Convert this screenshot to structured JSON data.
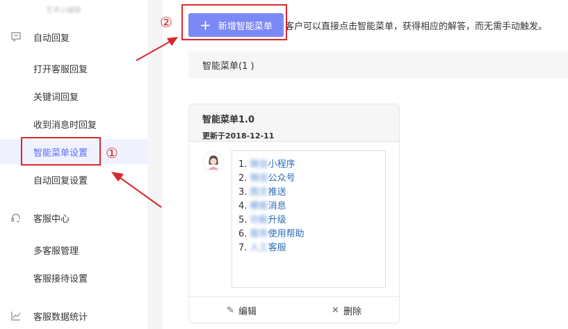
{
  "sidebar": {
    "logo_text": "艺术小编辑",
    "sections": [
      {
        "label": "自动回复",
        "icon": "chat-icon"
      },
      {
        "label": "客服中心",
        "icon": "headset-icon"
      },
      {
        "label": "客服数据统计",
        "icon": "chart-icon"
      }
    ],
    "items": [
      {
        "label": "打开客服回复"
      },
      {
        "label": "关键词回复"
      },
      {
        "label": "收到消息时回复"
      },
      {
        "label": "智能菜单设置"
      },
      {
        "label": "自动回复设置"
      },
      {
        "label": "多客服管理"
      },
      {
        "label": "客服接待设置"
      }
    ]
  },
  "main": {
    "add_button_label": "新增智能菜单",
    "description": "客户可以直接点击智能菜单，获得相应的解答，而无需手动触发。",
    "menu_bar_label": "智能菜单(1 )",
    "card": {
      "title": "智能菜单1.0",
      "updated": "更新于2018-12-11",
      "menu_items": [
        {
          "num": "1.",
          "blur": "微信",
          "text": "小程序"
        },
        {
          "num": "2.",
          "blur": "微信",
          "text": "公众号"
        },
        {
          "num": "3.",
          "blur": "图文",
          "text": "推送"
        },
        {
          "num": "4.",
          "blur": "模板",
          "text": "消息"
        },
        {
          "num": "5.",
          "blur": "功能",
          "text": "升级"
        },
        {
          "num": "6.",
          "blur": "服务",
          "text": "使用帮助"
        },
        {
          "num": "7.",
          "blur": "人工",
          "text": "客服"
        }
      ],
      "edit_label": "编辑",
      "delete_label": "删除"
    }
  },
  "annotations": {
    "marker_1": "①",
    "marker_2": "②",
    "color": "#d9262c"
  },
  "colors": {
    "accent": "#7b88f5",
    "active_bg": "#f0f2ff",
    "active_text": "#5b6ef5"
  }
}
